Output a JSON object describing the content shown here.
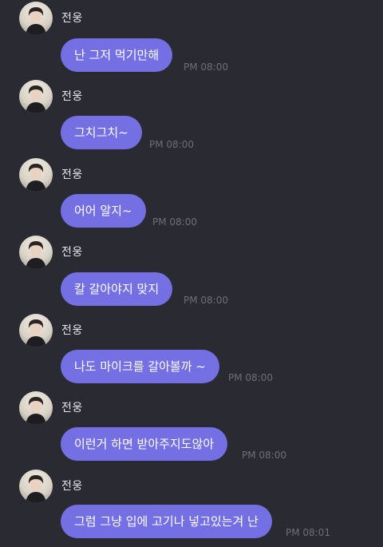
{
  "messages": [
    {
      "sender": "전웅",
      "text": "난 그저 먹기만해",
      "time": "PM 08:00"
    },
    {
      "sender": "전웅",
      "text": "그치그치~",
      "time": "PM 08:00"
    },
    {
      "sender": "전웅",
      "text": "어어 알지~",
      "time": "PM 08:00"
    },
    {
      "sender": "전웅",
      "text": "칼 갈아야지 맞지",
      "time": "PM 08:00"
    },
    {
      "sender": "전웅",
      "text": "나도 마이크를 갈아볼까 ~",
      "time": "PM 08:00"
    },
    {
      "sender": "전웅",
      "text": "이런거 하면 받아주지도않아",
      "time": "PM 08:00"
    },
    {
      "sender": "전웅",
      "text": "그럼 그냥 입에 고기나 넣고있는겨 난",
      "time": "PM 08:01"
    }
  ],
  "colors": {
    "background": "#2a2a33",
    "bubble": "#7470e3",
    "bubble_text": "#ffffff",
    "sender_text": "#e6e6ea",
    "time_text": "#6e6e78"
  },
  "icons": {
    "avatar": "profile-photo"
  }
}
